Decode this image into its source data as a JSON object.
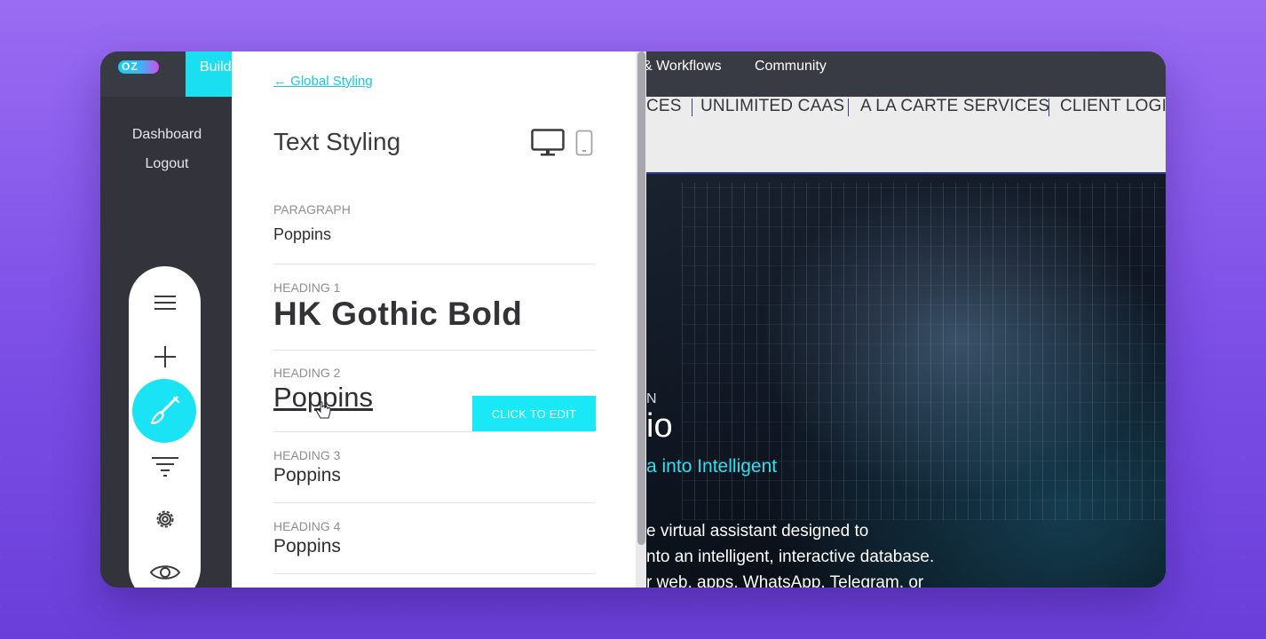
{
  "app": {
    "logo_text": "OZ",
    "top_nav": {
      "build_tab": "Build",
      "workflows": "& Workflows",
      "community": "Community"
    },
    "sidebar": {
      "dashboard": "Dashboard",
      "logout": "Logout"
    },
    "toolbar": [
      "menu-icon",
      "plus-icon",
      "paintbrush-icon",
      "filter-icon",
      "gear-icon",
      "eye-icon"
    ]
  },
  "panel": {
    "back_link": "← Global Styling",
    "title": "Text Styling",
    "sections": [
      {
        "label": "PARAGRAPH",
        "value": "Poppins"
      },
      {
        "label": "HEADING 1",
        "value": "HK Gothic Bold"
      },
      {
        "label": "HEADING 2",
        "value": "Poppins"
      },
      {
        "label": "HEADING 3",
        "value": "Poppins"
      },
      {
        "label": "HEADING 4",
        "value": "Poppins"
      }
    ],
    "click_to_edit": "CLICK TO EDIT"
  },
  "preview": {
    "nav": [
      "CES",
      "UNLIMITED CAAS",
      "A LA CARTE SERVICES",
      "CLIENT LOGIN"
    ],
    "hero": {
      "eyebrow": "N",
      "title": "io",
      "subtitle": "a into Intelligent",
      "body": [
        "e virtual assistant designed to",
        "nto an intelligent, interactive database.",
        "r web, apps, WhatsApp, Telegram, or"
      ]
    }
  },
  "colors": {
    "accent": "#19e3f4",
    "background": "#8b5cf0",
    "dark": "#33343b"
  }
}
